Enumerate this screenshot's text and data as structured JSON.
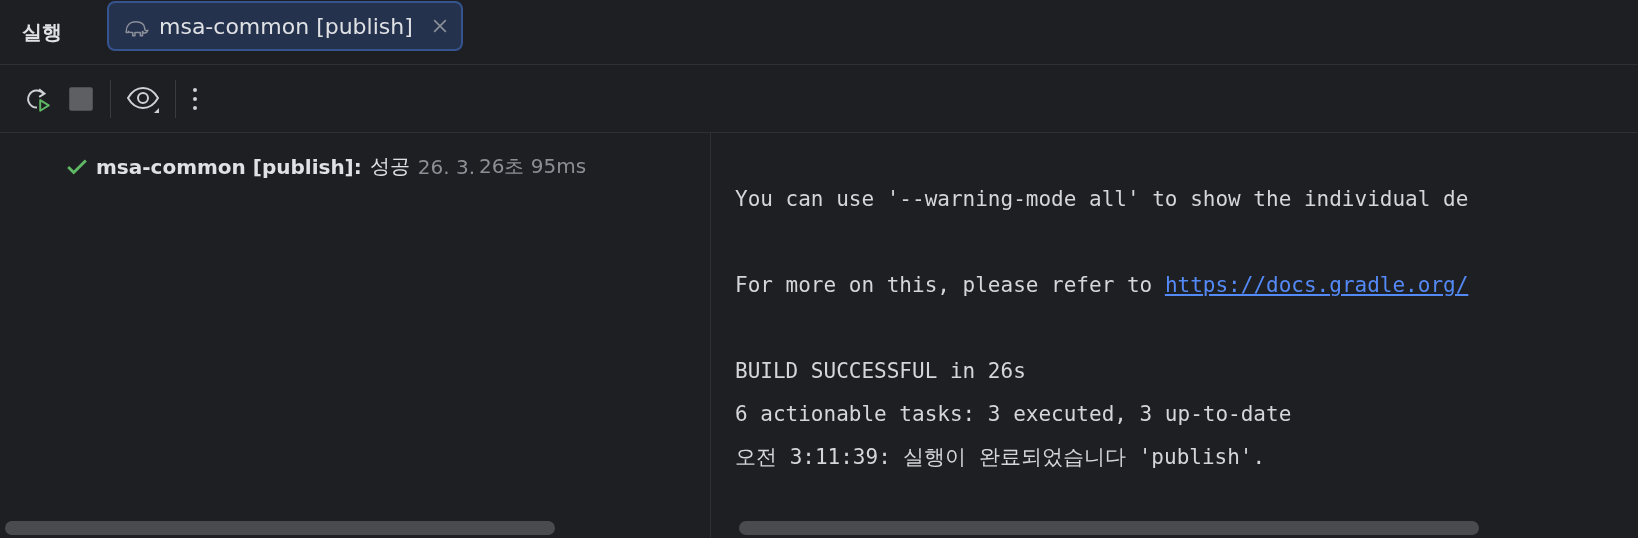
{
  "tool_window": {
    "title": "실행"
  },
  "tabs": [
    {
      "label": "msa-common [publish]",
      "selected": true
    }
  ],
  "tree": [
    {
      "kind": "success",
      "name": "msa-common [publish]:",
      "result": "성공",
      "date": "26. 3.",
      "duration": "26초 95ms"
    }
  ],
  "console": [
    {
      "kind": "blank"
    },
    {
      "kind": "text",
      "text": "You can use '--warning-mode all' to show the individual de"
    },
    {
      "kind": "blank"
    },
    {
      "kind": "link",
      "text": "For more on this, please refer to ",
      "link": "https://docs.gradle.org/"
    },
    {
      "kind": "blank"
    },
    {
      "kind": "text",
      "text": "BUILD SUCCESSFUL in 26s"
    },
    {
      "kind": "text",
      "text": "6 actionable tasks: 3 executed, 3 up-to-date"
    },
    {
      "kind": "text",
      "text": "오전 3:11:39: 실행이 완료되었습니다 'publish'."
    }
  ]
}
